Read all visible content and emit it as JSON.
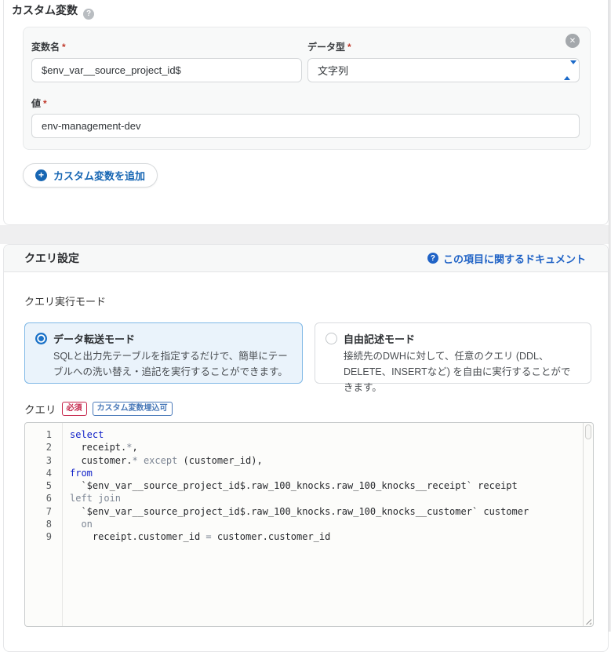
{
  "custom_vars": {
    "title": "カスタム変数",
    "required_mark": "*",
    "name_label": "変数名",
    "name_value": "$env_var__source_project_id$",
    "type_label": "データ型",
    "type_value": "文字列",
    "value_label": "値",
    "value_value": "env-management-dev",
    "add_button": "カスタム変数を追加",
    "close_glyph": "✕",
    "help_glyph": "?",
    "plus_glyph": "+"
  },
  "query_settings": {
    "title": "クエリ設定",
    "doc_link": "この項目に関するドキュメント",
    "doc_icon_glyph": "?",
    "exec_mode_label": "クエリ実行モード",
    "modes": [
      {
        "title": "データ転送モード",
        "desc": "SQLと出力先テーブルを指定するだけで、簡単にテーブルへの洗い替え・追記を実行することができます。",
        "selected": true
      },
      {
        "title": "自由記述モード",
        "desc": "接続先のDWHに対して、任意のクエリ (DDL、DELETE、INSERTなど) を自由に実行することができます。",
        "selected": false
      }
    ],
    "query_label": "クエリ",
    "badges": [
      {
        "label": "必須",
        "style": "red"
      },
      {
        "label": "カスタム変数埋込可",
        "style": "blue"
      }
    ],
    "editor": {
      "lines": [
        {
          "num": "1",
          "tokens": [
            {
              "t": "select",
              "c": "kw"
            }
          ]
        },
        {
          "num": "2",
          "tokens": [
            {
              "t": "  receipt.",
              "c": "tx"
            },
            {
              "t": "*",
              "c": "op"
            },
            {
              "t": ",",
              "c": "tx"
            }
          ]
        },
        {
          "num": "3",
          "tokens": [
            {
              "t": "  customer.",
              "c": "tx"
            },
            {
              "t": "*",
              "c": "op"
            },
            {
              "t": " ",
              "c": "tx"
            },
            {
              "t": "except",
              "c": "op"
            },
            {
              "t": " (customer_id),",
              "c": "tx"
            }
          ]
        },
        {
          "num": "4",
          "tokens": [
            {
              "t": "from",
              "c": "kw"
            }
          ]
        },
        {
          "num": "5",
          "tokens": [
            {
              "t": "  `$env_var__source_project_id$.raw_100_knocks.raw_100_knocks__receipt` receipt",
              "c": "tx"
            }
          ]
        },
        {
          "num": "6",
          "tokens": [
            {
              "t": "left join",
              "c": "op"
            }
          ]
        },
        {
          "num": "7",
          "tokens": [
            {
              "t": "  `$env_var__source_project_id$.raw_100_knocks.raw_100_knocks__customer` customer",
              "c": "tx"
            }
          ]
        },
        {
          "num": "8",
          "tokens": [
            {
              "t": "  on",
              "c": "op"
            }
          ]
        },
        {
          "num": "9",
          "tokens": [
            {
              "t": "    receipt.customer_id ",
              "c": "tx"
            },
            {
              "t": "=",
              "c": "op"
            },
            {
              "t": " customer.customer_id",
              "c": "tx"
            }
          ]
        }
      ]
    }
  },
  "colors": {
    "keyword": "#1021c8",
    "secondary_token": "#7d8694",
    "accent_blue": "#1766b3",
    "selected_card_bg": "#eaf3fb",
    "selected_card_border": "#7fb8e6",
    "badge_red": "#c5254b",
    "badge_blue": "#4878b8",
    "link_blue": "#2063c6"
  }
}
